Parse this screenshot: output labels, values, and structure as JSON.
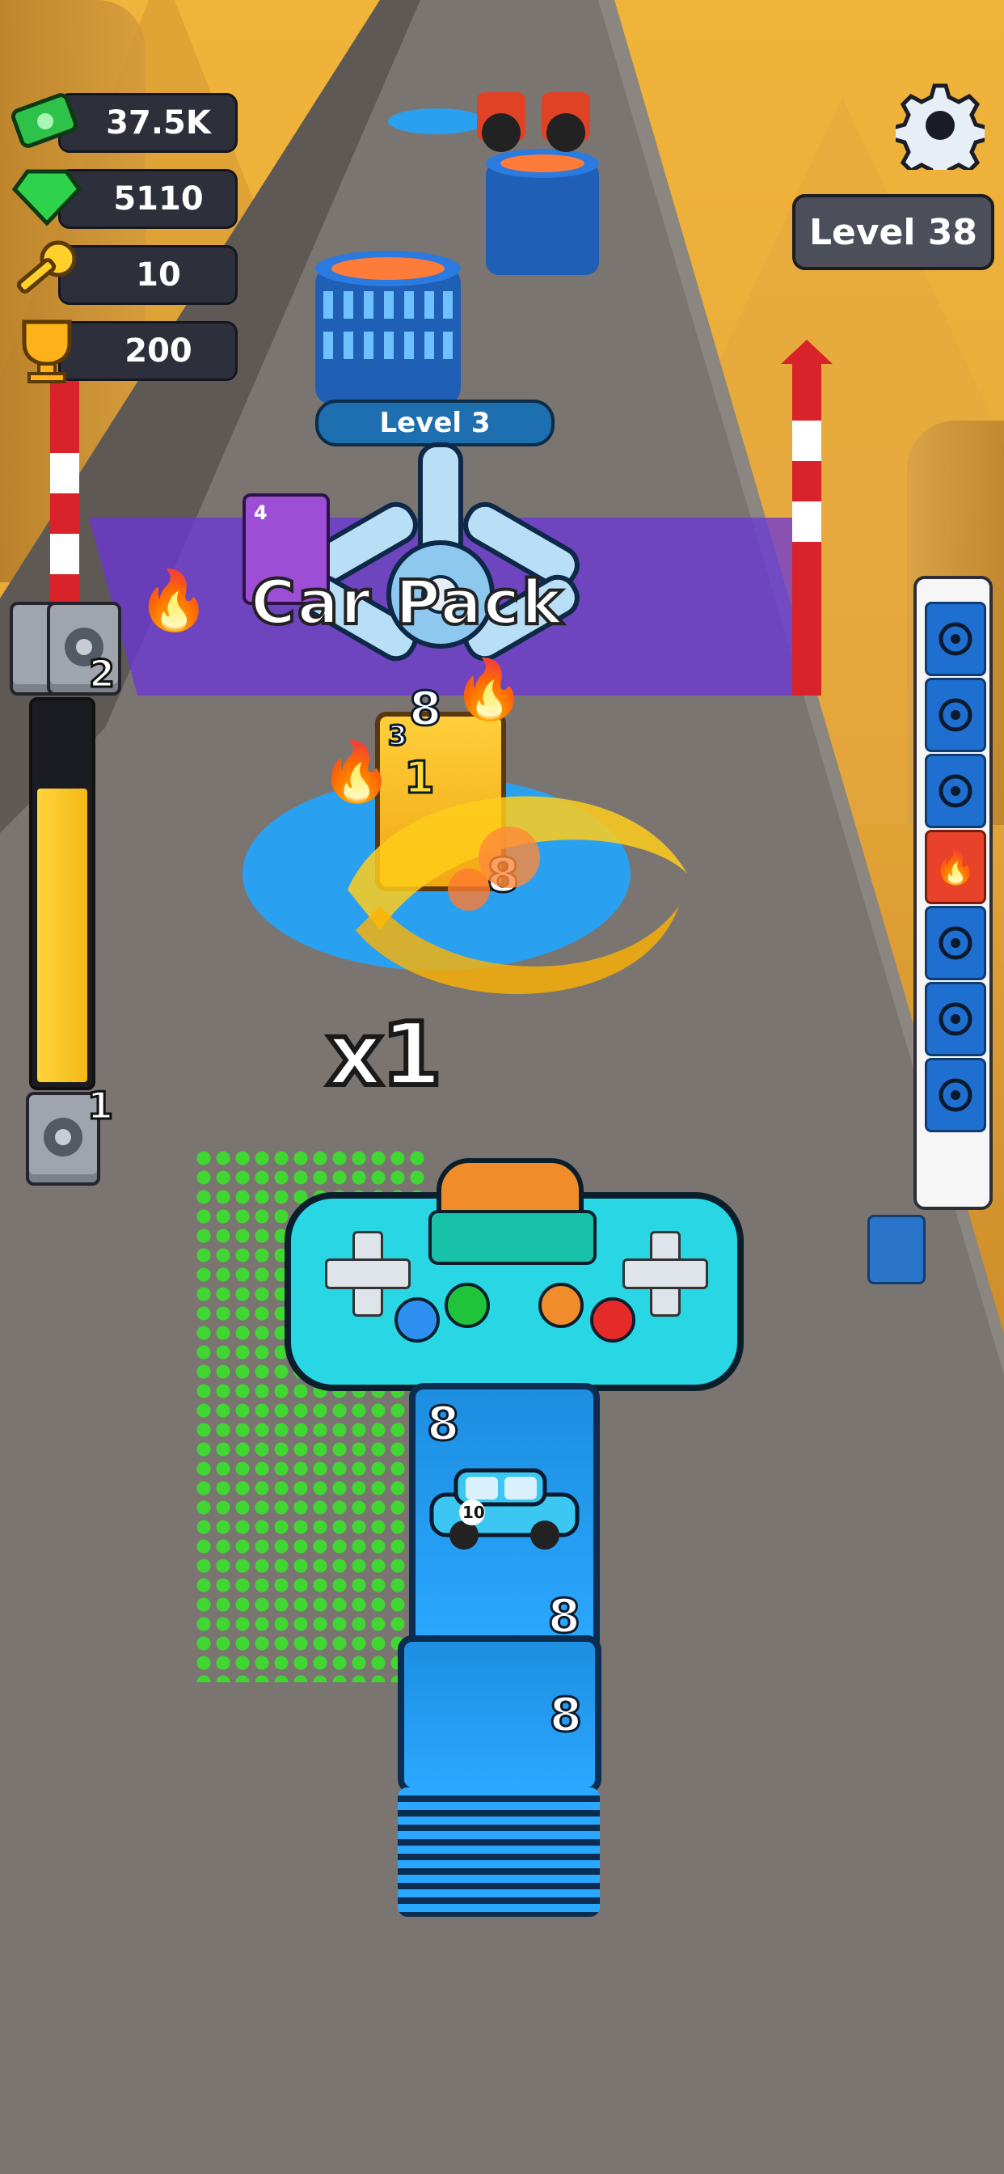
{
  "hud": {
    "cash": "37.5K",
    "gems": "5110",
    "keys": "10",
    "trophies": "200",
    "level": "Level 38"
  },
  "track": {
    "upgrade_tower_level": "Level 3",
    "gate_text": "Car  Pack",
    "multiplier": "x1",
    "pack_card_value": "4"
  },
  "left_meter": {
    "top_count": "2",
    "bottom_count": "1",
    "fill_fraction": 0.78
  },
  "player": {
    "front_card_top": "8",
    "front_card_bottom": "8",
    "second_card": "8",
    "car_number": "10"
  },
  "fx_numbers": {
    "tower_top": "8",
    "gold_card_top": "3",
    "gold_card_mid": "1",
    "burst": "8"
  },
  "side_track": {
    "cells": [
      "gear",
      "gear",
      "gear",
      "fire",
      "gear",
      "gear",
      "gear"
    ]
  },
  "colors": {
    "road": "#7a7470",
    "accent_blue": "#1e6fd0",
    "gate_purple": "#6a36d8",
    "controller": "#29d6e3"
  },
  "icons": [
    "cash-icon",
    "gem-icon",
    "key-icon",
    "trophy-icon",
    "gear-icon",
    "tire-icon",
    "fire-icon",
    "wheel-icon"
  ]
}
